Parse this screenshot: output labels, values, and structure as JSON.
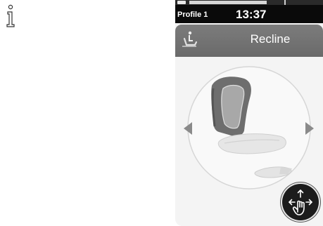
{
  "status_bar": {
    "profile_label": "Profile 1",
    "time": "13:37"
  },
  "header": {
    "title": "Recline",
    "icon": "seat-recline-icon"
  },
  "navigation": {
    "left_icon": "arrow-left-icon",
    "right_icon": "arrow-right-icon"
  },
  "actions": {
    "move_icon": "hand-move-icon"
  },
  "info_icon": "info-icon",
  "colors": {
    "background": "#f4f4f4",
    "title_bar": "#727272",
    "status_bar": "#0a0a0a",
    "seat_back": "#707070",
    "arrow": "#8a8a8a"
  }
}
